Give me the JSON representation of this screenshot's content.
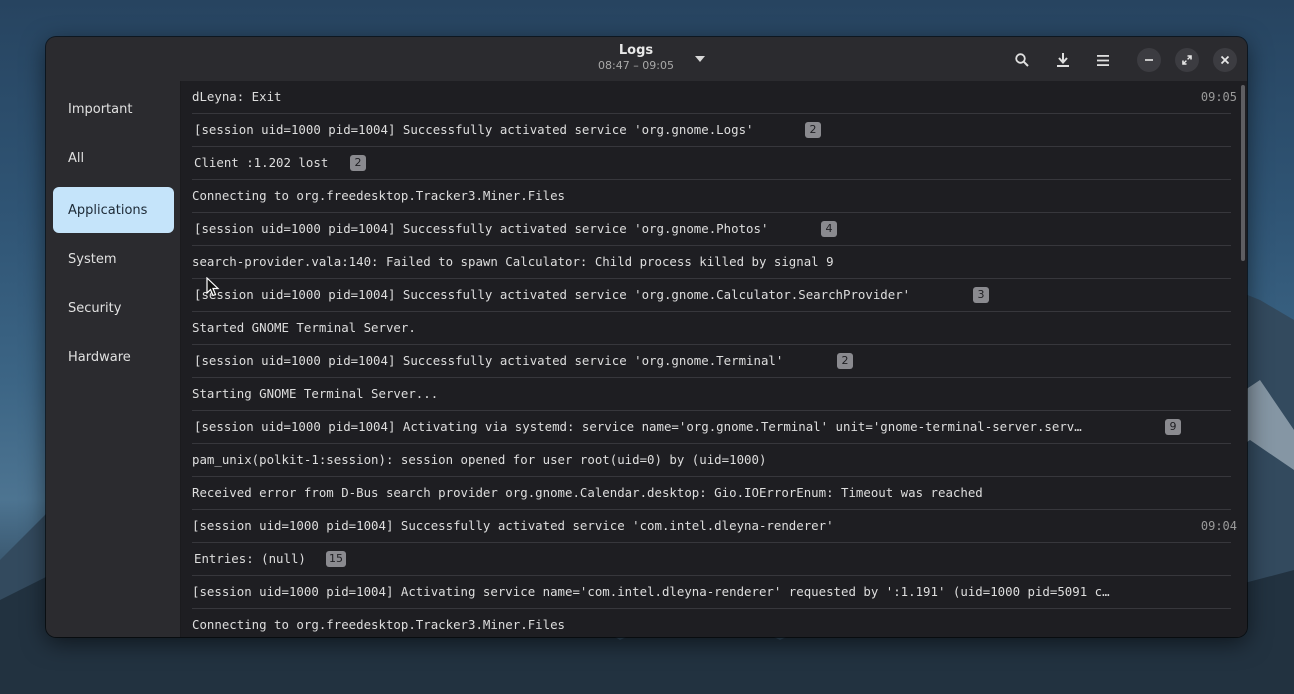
{
  "window": {
    "title": "Logs",
    "subtitle": "08:47 – 09:05",
    "icons": {
      "dropdown": "chevron-down-icon",
      "search": "search-icon",
      "export": "download-icon",
      "menu": "hamburger-menu-icon",
      "minimize": "minimize-icon",
      "maximize": "maximize-icon",
      "close": "close-icon"
    }
  },
  "sidebar": {
    "items": [
      {
        "label": "Important",
        "active": false
      },
      {
        "label": "All",
        "active": false
      },
      {
        "label": "Applications",
        "active": true
      },
      {
        "label": "System",
        "active": false
      },
      {
        "label": "Security",
        "active": false
      },
      {
        "label": "Hardware",
        "active": false
      }
    ]
  },
  "logs": [
    {
      "message": "dLeyna: Exit",
      "time": "09:05"
    },
    {
      "message": "[session uid=1000 pid=1004] Successfully activated service 'org.gnome.Logs'",
      "count": "2"
    },
    {
      "message": "Client :1.202 lost",
      "count": "2"
    },
    {
      "message": "Connecting to org.freedesktop.Tracker3.Miner.Files"
    },
    {
      "message": "[session uid=1000 pid=1004] Successfully activated service 'org.gnome.Photos'",
      "count": "4"
    },
    {
      "message": "search-provider.vala:140: Failed to spawn Calculator: Child process killed by signal 9"
    },
    {
      "message": "[session uid=1000 pid=1004] Successfully activated service 'org.gnome.Calculator.SearchProvider'",
      "count": "3"
    },
    {
      "message": "Started GNOME Terminal Server."
    },
    {
      "message": "[session uid=1000 pid=1004] Successfully activated service 'org.gnome.Terminal'",
      "count": "2"
    },
    {
      "message": "Starting GNOME Terminal Server..."
    },
    {
      "message": "[session uid=1000 pid=1004] Activating via systemd: service name='org.gnome.Terminal' unit='gnome-terminal-server.serv…",
      "count": "9"
    },
    {
      "message": "pam_unix(polkit-1:session): session opened for user root(uid=0) by (uid=1000)"
    },
    {
      "message": "Received error from D-Bus search provider org.gnome.Calendar.desktop: Gio.IOErrorEnum: Timeout was reached"
    },
    {
      "message": "[session uid=1000 pid=1004] Successfully activated service 'com.intel.dleyna-renderer'",
      "time": "09:04"
    },
    {
      "message": "Entries: (null)",
      "count": "15"
    },
    {
      "message": "[session uid=1000 pid=1004] Activating service name='com.intel.dleyna-renderer' requested by ':1.191' (uid=1000 pid=5091 c…"
    },
    {
      "message": "Connecting to org.freedesktop.Tracker3.Miner.Files"
    }
  ],
  "colors": {
    "accent": "#c5e4fa",
    "badge": "#8a8a8f"
  }
}
